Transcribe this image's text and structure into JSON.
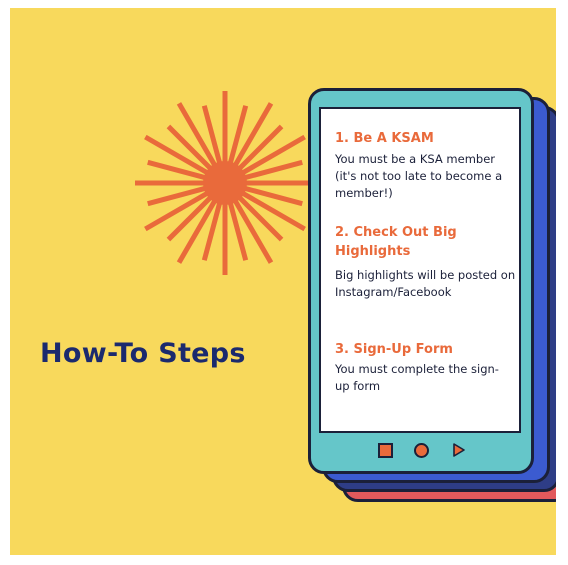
{
  "heading": "How-To Steps",
  "colors": {
    "background": "#F8D95C",
    "heading": "#1B2A6E",
    "accent": "#E96A3B",
    "phone": "#65C6C9",
    "layer_blue": "#3B5BD0",
    "layer_navy": "#2E3D86",
    "layer_red": "#E2595C"
  },
  "steps": [
    {
      "title": "1. Be A KSAM",
      "body": "You must be a KSA member (it's not too late to become a member!)"
    },
    {
      "title": "2. Check Out Big Highlights",
      "body": "Big highlights will be posted on Instagram/Facebook"
    },
    {
      "title": "3. Sign-Up Form",
      "body": "You must complete the sign-up form"
    }
  ],
  "phone_nav_icons": [
    "square-icon",
    "circle-icon",
    "play-icon"
  ]
}
